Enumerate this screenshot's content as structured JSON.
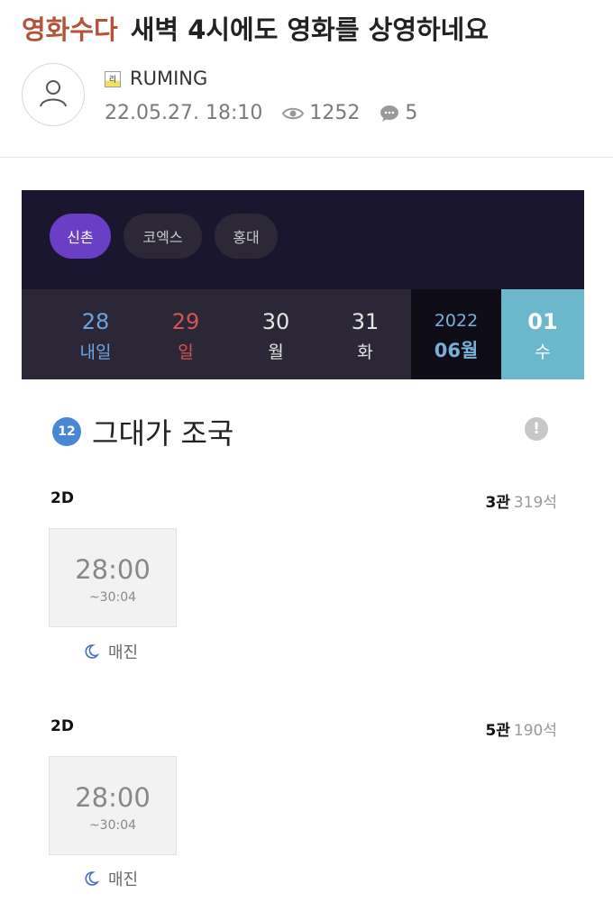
{
  "post": {
    "board": "영화수다",
    "title": "새벽 4시에도 영화를 상영하네요",
    "author": "RUMING",
    "level_badge": "리",
    "date": "22.05.27. 18:10",
    "views": "1252",
    "comments": "5"
  },
  "cinemas": [
    {
      "label": "신촌",
      "active": true
    },
    {
      "label": "코엑스",
      "active": false
    },
    {
      "label": "홍대",
      "active": false
    }
  ],
  "dates": [
    {
      "num": "28",
      "day": "내일",
      "color": "#6ea3dd"
    },
    {
      "num": "29",
      "day": "일",
      "color": "#d65454"
    },
    {
      "num": "30",
      "day": "월",
      "color": "#e4e4e4"
    },
    {
      "num": "31",
      "day": "화",
      "color": "#e4e4e4"
    }
  ],
  "month": {
    "year": "2022",
    "month": "06월"
  },
  "selected_date": {
    "num": "01",
    "day": "수"
  },
  "movie": {
    "rating": "12",
    "title": "그대가 조국",
    "info_icon": "!"
  },
  "showings": [
    {
      "format": "2D",
      "hall": "3관",
      "seats": "319석",
      "start": "28:00",
      "end": "~30:04",
      "status": "매진"
    },
    {
      "format": "2D",
      "hall": "5관",
      "seats": "190석",
      "start": "28:00",
      "end": "~30:04",
      "status": "매진"
    }
  ],
  "icons": {
    "avatar": "user-icon",
    "views": "eye-icon",
    "comments": "speech-bubble-icon",
    "soldout": "moon-icon",
    "info": "info-icon"
  }
}
